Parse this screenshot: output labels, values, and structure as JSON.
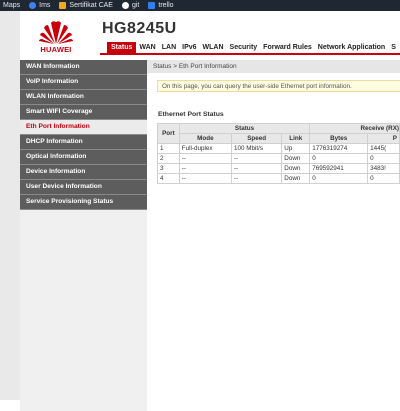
{
  "bookmarks": [
    {
      "label": "Maps",
      "icon": "maps-icon",
      "color": "#4caf50"
    },
    {
      "label": "Ims",
      "icon": "globe-icon",
      "color": "#3b82f6"
    },
    {
      "label": "Sertifikat CAE",
      "icon": "certificate-icon",
      "color": "#f5a623"
    },
    {
      "label": "git",
      "icon": "github-icon",
      "color": "#ffffff"
    },
    {
      "label": "trello",
      "icon": "trello-icon",
      "color": "#2f80ed"
    }
  ],
  "header": {
    "brand": "HUAWEI",
    "model": "HG8245U",
    "brand_color": "#c7000b"
  },
  "nav": {
    "items": [
      "Status",
      "WAN",
      "LAN",
      "IPv6",
      "WLAN",
      "Security",
      "Forward Rules",
      "Network Application",
      "S"
    ],
    "active": "Status"
  },
  "sidebar": {
    "items": [
      {
        "label": "WAN Information",
        "active": false
      },
      {
        "label": "VoIP Information",
        "active": false
      },
      {
        "label": "WLAN Information",
        "active": false
      },
      {
        "label": "Smart WIFI Coverage",
        "active": false
      },
      {
        "label": "Eth Port Information",
        "active": true
      },
      {
        "label": "DHCP Information",
        "active": false
      },
      {
        "label": "Optical Information",
        "active": false
      },
      {
        "label": "Device Information",
        "active": false
      },
      {
        "label": "User Device Information",
        "active": false
      },
      {
        "label": "Service Provisioning Status",
        "active": false
      }
    ]
  },
  "content": {
    "breadcrumb": "Status > Eth Port Information",
    "info": "On this page, you can query the user-side Ethernet port information.",
    "section_title": "Ethernet Port Status",
    "table": {
      "header_port": "Port",
      "header_status": "Status",
      "header_receive": "Receive (RX)",
      "header_mode": "Mode",
      "header_speed": "Speed",
      "header_link": "Link",
      "header_bytes": "Bytes",
      "header_more": "P",
      "rows": [
        {
          "port": "1",
          "mode": "Full-duplex",
          "speed": "100 Mbit/s",
          "link": "Up",
          "bytes": "1776319274",
          "more": "1445("
        },
        {
          "port": "2",
          "mode": "--",
          "speed": "--",
          "link": "Down",
          "bytes": "0",
          "more": "0"
        },
        {
          "port": "3",
          "mode": "--",
          "speed": "--",
          "link": "Down",
          "bytes": "769592941",
          "more": "3483!"
        },
        {
          "port": "4",
          "mode": "--",
          "speed": "--",
          "link": "Down",
          "bytes": "0",
          "more": "0"
        }
      ]
    }
  }
}
